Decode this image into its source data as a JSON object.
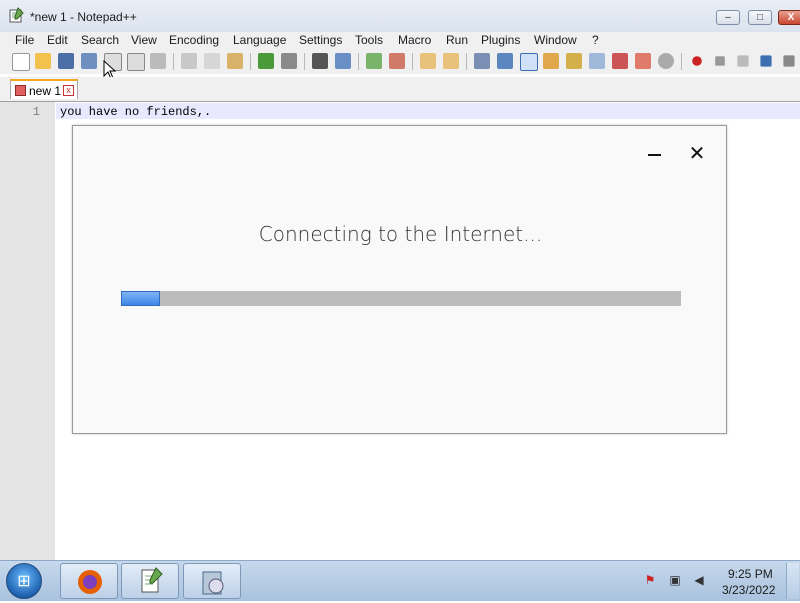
{
  "window": {
    "title": "*new 1 - Notepad++"
  },
  "window_buttons": {
    "minimize": "–",
    "maximize": "□",
    "close": "X"
  },
  "menu": [
    "File",
    "Edit",
    "Search",
    "View",
    "Encoding",
    "Language",
    "Settings",
    "Tools",
    "Macro",
    "Run",
    "Plugins",
    "Window",
    "?"
  ],
  "toolbar_icons": [
    "new-icon",
    "open-icon",
    "save-icon",
    "save-all-icon",
    "close-icon",
    "close-all-icon",
    "print-icon",
    "cut-icon",
    "copy-icon",
    "paste-icon",
    "undo-icon",
    "redo-icon",
    "find-icon",
    "replace-icon",
    "zoom-in-icon",
    "zoom-out-icon",
    "sync-v-icon",
    "sync-h-icon",
    "word-wrap-icon",
    "all-chars-icon",
    "indent-guide-icon",
    "udl-icon",
    "doc-map-icon",
    "doc-list-icon",
    "function-list-icon",
    "folder-workspace-icon",
    "monitoring-icon",
    "record-macro-icon",
    "stop-macro-icon",
    "play-macro-icon",
    "run-macro-multiple-icon",
    "save-macro-icon"
  ],
  "tabs": [
    {
      "label": "new 1",
      "close": "x"
    }
  ],
  "editor": {
    "line_numbers": [
      "1"
    ],
    "lines": [
      "you have no friends,."
    ]
  },
  "dialog": {
    "minimize": "",
    "close": "✕",
    "title": "Connecting to the Internet...",
    "progress": 0.07
  },
  "taskbar": {
    "start": "⊞",
    "apps": [
      {
        "name": "firefox-icon"
      },
      {
        "name": "notepad-plus-plus-icon"
      },
      {
        "name": "installer-icon"
      }
    ],
    "time": "9:25 PM",
    "date": "3/23/2022"
  }
}
